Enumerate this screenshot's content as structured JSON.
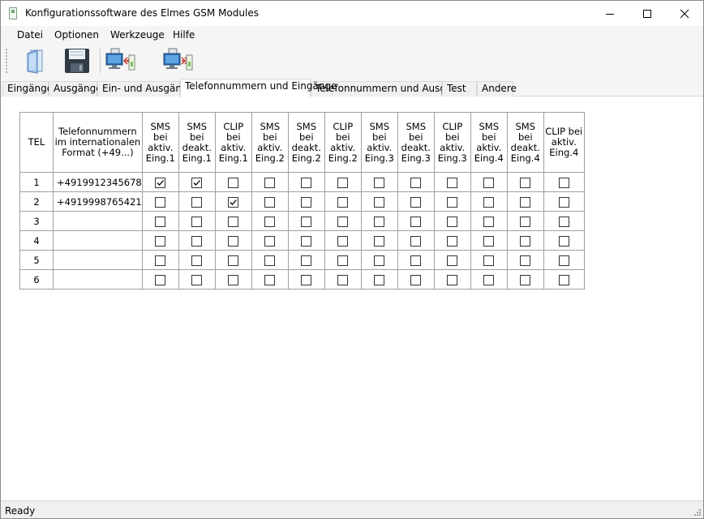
{
  "window": {
    "title": "Konfigurationssoftware des Elmes GSM Modules"
  },
  "menu": [
    "Datei",
    "Optionen",
    "Werkzeuge",
    "Hilfe"
  ],
  "tabs": [
    "Eingänge",
    "Ausgänge",
    "Ein- und Ausgänge",
    "Telefonnummern und Eingänge",
    "Telefonnummern und Ausgänge",
    "Test",
    "Andere"
  ],
  "active_tab": "Telefonnummern und Eingänge",
  "toolbar": [
    "open-icon",
    "save-icon",
    "read-from-module-icon",
    "write-to-module-icon"
  ],
  "table": {
    "headers": [
      "TEL",
      "Telefonnummern im internationalen Format (+49...)",
      "SMS bei aktiv. Eing.1",
      "SMS bei deakt. Eing.1",
      "CLIP bei aktiv. Eing.1",
      "SMS bei aktiv. Eing.2",
      "SMS bei deakt. Eing.2",
      "CLIP bei aktiv. Eing.2",
      "SMS bei aktiv. Eing.3",
      "SMS bei deakt. Eing.3",
      "CLIP bei aktiv. Eing.3",
      "SMS bei aktiv. Eing.4",
      "SMS bei deakt. Eing.4",
      "CLIP bei aktiv. Eing.4"
    ],
    "rows": [
      {
        "tel": "1",
        "phone": "+4919912345678",
        "checks": [
          true,
          true,
          false,
          false,
          false,
          false,
          false,
          false,
          false,
          false,
          false,
          false
        ]
      },
      {
        "tel": "2",
        "phone": "+4919998765421",
        "checks": [
          false,
          false,
          true,
          false,
          false,
          false,
          false,
          false,
          false,
          false,
          false,
          false
        ]
      },
      {
        "tel": "3",
        "phone": "",
        "checks": [
          false,
          false,
          false,
          false,
          false,
          false,
          false,
          false,
          false,
          false,
          false,
          false
        ]
      },
      {
        "tel": "4",
        "phone": "",
        "checks": [
          false,
          false,
          false,
          false,
          false,
          false,
          false,
          false,
          false,
          false,
          false,
          false
        ]
      },
      {
        "tel": "5",
        "phone": "",
        "checks": [
          false,
          false,
          false,
          false,
          false,
          false,
          false,
          false,
          false,
          false,
          false,
          false
        ]
      },
      {
        "tel": "6",
        "phone": "",
        "checks": [
          false,
          false,
          false,
          false,
          false,
          false,
          false,
          false,
          false,
          false,
          false,
          false
        ]
      }
    ]
  },
  "status": "Ready"
}
